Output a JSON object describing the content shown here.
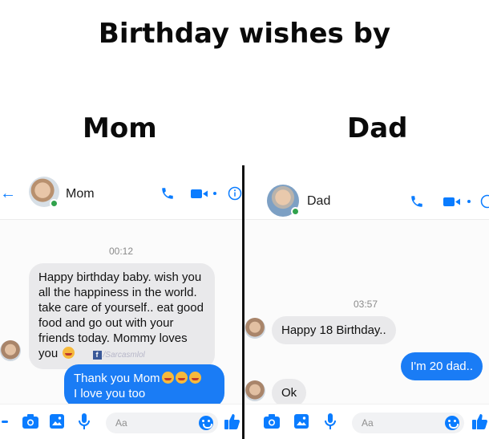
{
  "meme": {
    "title": "Birthday wishes by",
    "left_label": "Mom",
    "right_label": "Dad"
  },
  "mom_chat": {
    "contact_name": "Mom",
    "timestamp": "00:12",
    "incoming": [
      {
        "text": "Happy birthday baby. wish you all the happiness in the world. take care of yourself.. eat good food and go out with your friends today. Mommy loves you",
        "emoji": "kissing-face"
      }
    ],
    "watermark": "/Sarcasmlol",
    "outgoing": [
      {
        "line1": "Thank you Mom",
        "line2": "I love you too",
        "emoji": "kissing-face"
      }
    ],
    "compose_placeholder": "Aa"
  },
  "dad_chat": {
    "contact_name": "Dad",
    "timestamp": "03:57",
    "incoming": [
      {
        "text": "Happy 18 Birthday.."
      },
      {
        "text": "Ok"
      }
    ],
    "outgoing": [
      {
        "text": "I'm 20 dad.."
      }
    ],
    "compose_placeholder": "Aa"
  },
  "colors": {
    "accent": "#0a7cff",
    "outgoing_bubble": "#1a7cf5",
    "incoming_bubble": "#e9e9eb",
    "online": "#31a24c"
  },
  "icons": [
    "back-arrow-icon",
    "phone-icon",
    "video-camera-icon",
    "info-icon",
    "camera-icon",
    "image-icon",
    "microphone-icon",
    "emoji-icon",
    "thumbs-up-icon"
  ]
}
